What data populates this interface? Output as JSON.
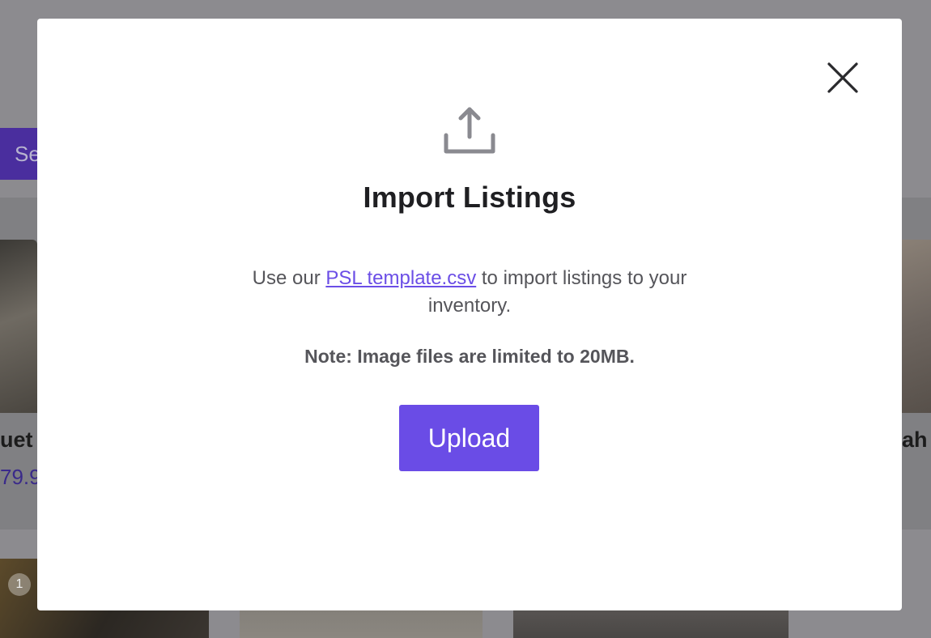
{
  "background": {
    "search_button_label": "Se",
    "card_left_title": "uet",
    "card_left_price": "79.9",
    "card_right_title": "ah",
    "row2_badge": "1"
  },
  "modal": {
    "close_icon": "close-icon",
    "upload_icon": "upload-icon",
    "title": "Import Listings",
    "description_prefix": "Use our ",
    "template_link": "PSL template.csv",
    "description_suffix": " to import listings to your inventory.",
    "note": "Note: Image files are limited to 20MB.",
    "upload_button": "Upload"
  },
  "colors": {
    "accent": "#6a4ce6",
    "link": "#6b4ee6",
    "overlay": "#8c8b8f"
  }
}
